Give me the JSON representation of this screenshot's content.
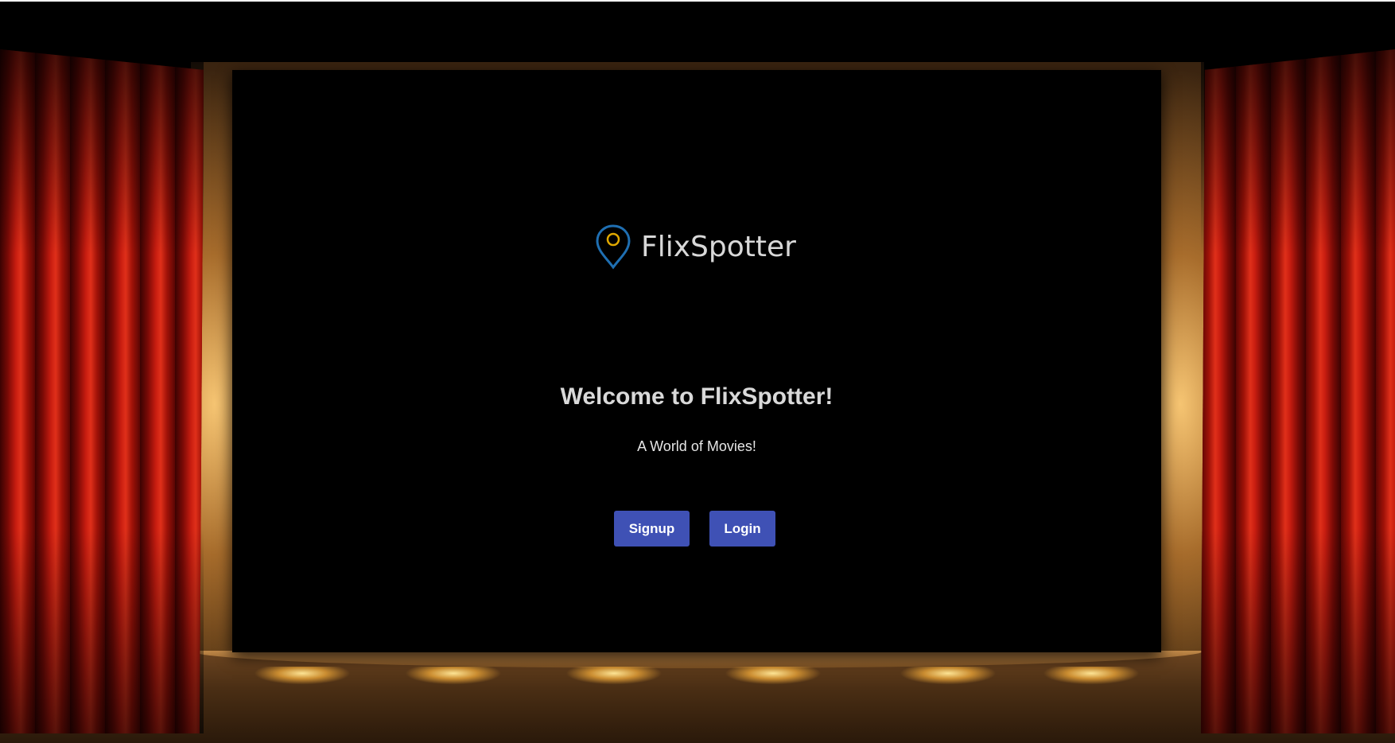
{
  "brand": {
    "name": "FlixSpotter",
    "logo_icon": "map-pin-icon",
    "pin_color": "#1f6fb2",
    "pin_dot_color": "#e0a800"
  },
  "hero": {
    "title": "Welcome to FlixSpotter!",
    "tagline": "A World of Movies!"
  },
  "actions": {
    "signup_label": "Signup",
    "login_label": "Login",
    "button_color": "#3f51b5"
  },
  "scene": {
    "background": "theater-stage",
    "curtain_color": "#c81d10"
  }
}
